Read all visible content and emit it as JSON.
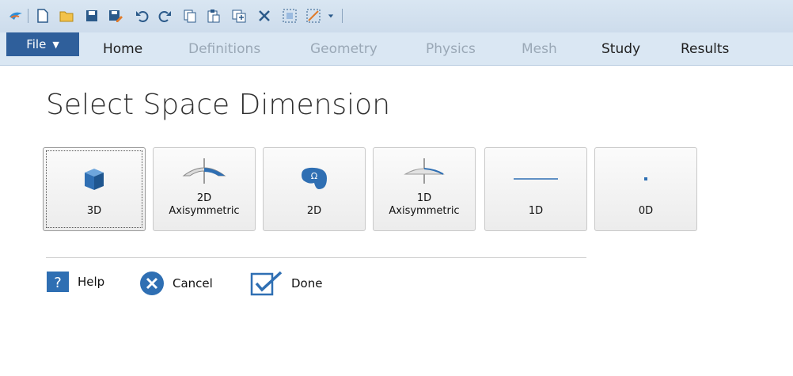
{
  "quick_access_toolbar": {
    "items": [
      "app-icon",
      "new-icon",
      "open-icon",
      "save-icon",
      "save-as-icon",
      "undo-icon",
      "redo-icon",
      "copy-icon",
      "paste-icon",
      "duplicate-icon",
      "delete-icon",
      "select-all-icon",
      "clear-selection-icon",
      "customize-dropdown-icon"
    ]
  },
  "ribbon": {
    "file_label": "File",
    "tabs": [
      {
        "label": "Home",
        "enabled": true
      },
      {
        "label": "Definitions",
        "enabled": false
      },
      {
        "label": "Geometry",
        "enabled": false
      },
      {
        "label": "Physics",
        "enabled": false
      },
      {
        "label": "Mesh",
        "enabled": false
      },
      {
        "label": "Study",
        "enabled": true
      },
      {
        "label": "Results",
        "enabled": true
      }
    ]
  },
  "page": {
    "title": "Select Space Dimension",
    "dimensions": [
      {
        "id": "3d",
        "label": "3D",
        "icon": "cube-icon",
        "selected": true
      },
      {
        "id": "2d-axi",
        "label": "2D\nAxisymmetric",
        "icon": "axisymmetric-2d-icon",
        "selected": false
      },
      {
        "id": "2d",
        "label": "2D",
        "icon": "omega-domain-icon",
        "selected": false
      },
      {
        "id": "1d-axi",
        "label": "1D\nAxisymmetric",
        "icon": "axisymmetric-1d-icon",
        "selected": false
      },
      {
        "id": "1d",
        "label": "1D",
        "icon": "line-icon",
        "selected": false
      },
      {
        "id": "0d",
        "label": "0D",
        "icon": "point-icon",
        "selected": false
      }
    ],
    "actions": {
      "help_label": "Help",
      "cancel_label": "Cancel",
      "done_label": "Done"
    }
  },
  "colors": {
    "accent": "#2f6fb3",
    "file_tab": "#2f5f9b",
    "ribbon_bg": "#dae7f3",
    "disabled_tab_text": "#9aa8b6"
  }
}
